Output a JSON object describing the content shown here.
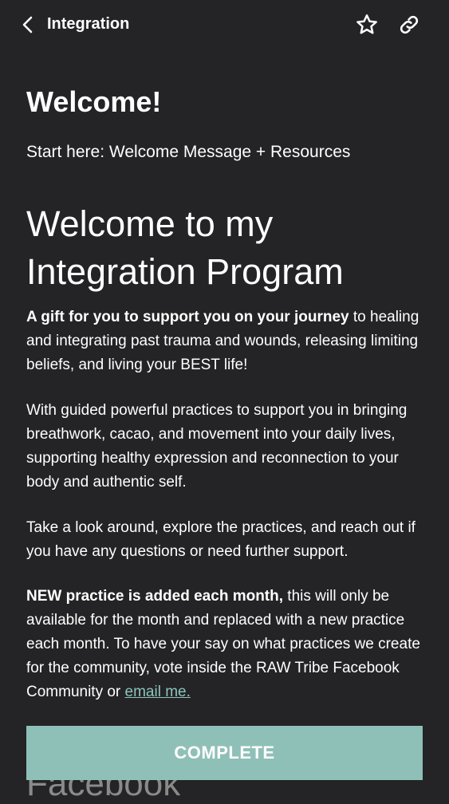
{
  "header": {
    "title": "Integration",
    "back_icon": "chevron-left-icon",
    "star_icon": "star-outline-icon",
    "link_icon": "link-icon"
  },
  "main": {
    "heading": "Welcome!",
    "subtitle": "Start here: Welcome Message + Resources",
    "program_title": "Welcome to my Integration Program",
    "p1_bold": "A gift for you to support you on your journey",
    "p1_rest": " to healing and integrating past trauma and wounds, releasing limiting beliefs, and living your BEST life!",
    "p2": "With guided powerful practices to support you in bringing breathwork, cacao, and movement into your daily lives, supporting healthy expression and reconnection to your body and authentic self.",
    "p3": "Take a look around, explore the practices, and reach out if you have any questions or need further support.",
    "p4_bold": "NEW practice is added each month,",
    "p4_rest": " this will only be available for the month and replaced with a new practice each month. To have your say on what practices we create for the community, vote inside the RAW Tribe Facebook Community or ",
    "p4_link": "email me.",
    "behind_button_text": "Facebook"
  },
  "footer": {
    "complete_label": "COMPLETE"
  },
  "colors": {
    "background": "#242325",
    "accent": "#8fc0b8",
    "link": "#8cc4bb",
    "text": "#ffffff"
  }
}
